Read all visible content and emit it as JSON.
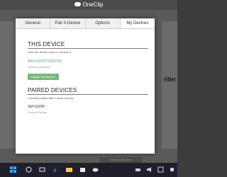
{
  "window": {
    "title": "OneClip"
  },
  "background": {
    "partial_text": "riter"
  },
  "tabs": [
    {
      "label": "General",
      "active": false
    },
    {
      "label": "Pair A Device",
      "active": false
    },
    {
      "label": "Options",
      "active": false
    },
    {
      "label": "My Devices",
      "active": true
    }
  ],
  "this_device": {
    "heading": "THIS DEVICE",
    "subtitle": "Click the device name to rename it",
    "name": "WIN-KDOR7I1FB7S8",
    "type": "Windows Desktop",
    "unpair_label": "Unpair This Device"
  },
  "paired_devices": {
    "heading": "PAIRED DEVICES",
    "subtitle": "Currently paired with 1 other devices",
    "items": [
      {
        "name": "SM-G925F",
        "type": "Android Device"
      }
    ]
  },
  "taskbar": {
    "notification_text": "Seen tooltip here"
  },
  "colors": {
    "accent_green": "#7ab77a",
    "device_link": "#5fa65f",
    "taskbar": "#1f1f2b"
  }
}
